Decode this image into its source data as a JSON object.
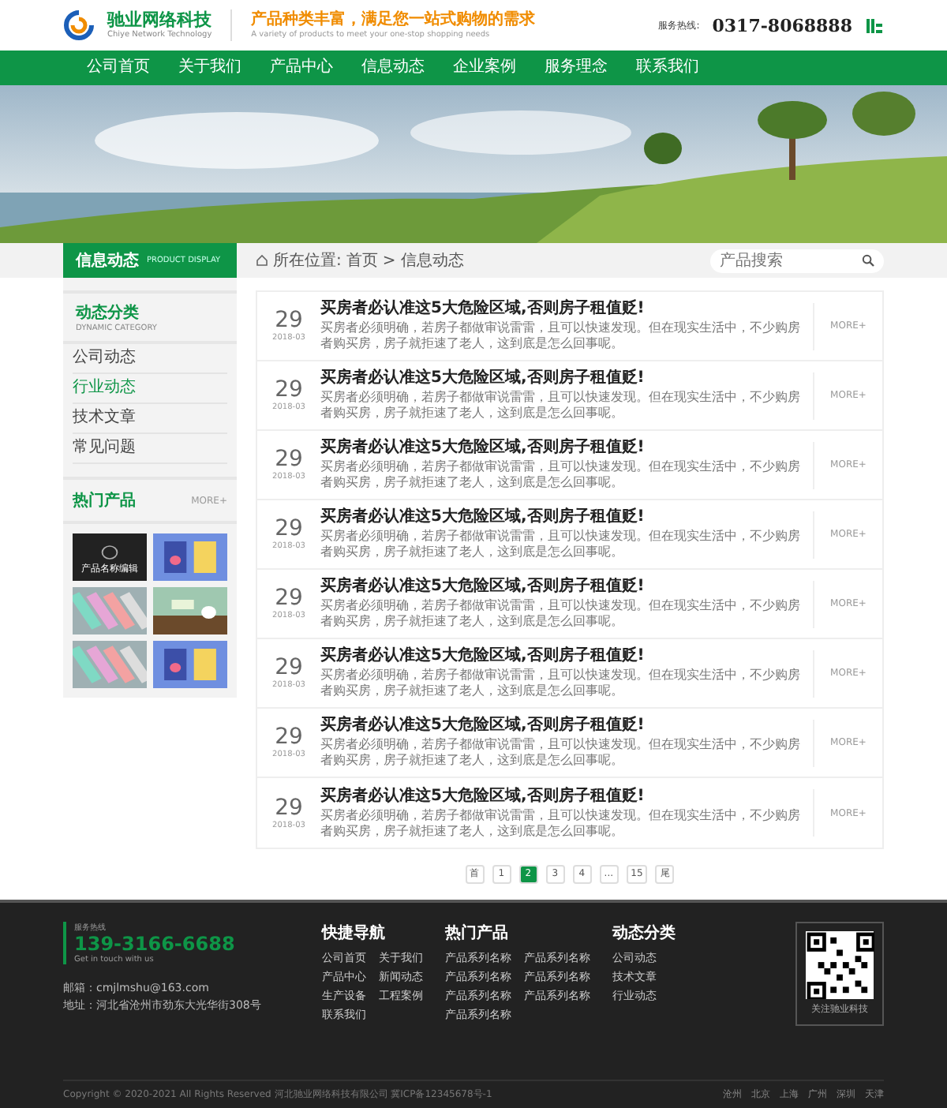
{
  "header": {
    "logo_name": "驰业网络科技",
    "logo_sub": "Chiye Network Technology",
    "slogan": "产品种类丰富，满足您一站式购物的需求",
    "slogan_en": "A variety of products to meet your one-stop shopping needs",
    "hotline_label": "服务热线:",
    "hotline": "0317-8068888"
  },
  "nav": [
    {
      "label": "公司首页",
      "selected": false
    },
    {
      "label": "关于我们",
      "selected": false
    },
    {
      "label": "产品中心",
      "selected": false
    },
    {
      "label": "信息动态",
      "selected": false
    },
    {
      "label": "企业案例",
      "selected": false
    },
    {
      "label": "服务理念",
      "selected": false
    },
    {
      "label": "联系我们",
      "selected": false
    }
  ],
  "section": {
    "title": "信息动态",
    "subtitle": "PRODUCT DISPLAY"
  },
  "breadcrumb": {
    "label": "所在位置:",
    "items": [
      "首页",
      "信息动态"
    ],
    "separator": ">"
  },
  "search": {
    "placeholder": "产品搜索"
  },
  "sidebar": {
    "title": "动态分类",
    "subtitle": "DYNAMIC CATEGORY",
    "items": [
      {
        "label": "公司动态",
        "selected": false
      },
      {
        "label": "行业动态",
        "selected": true
      },
      {
        "label": "技术文章",
        "selected": false
      },
      {
        "label": "常见问题",
        "selected": false
      }
    ],
    "hot_title": "热门产品",
    "hot_more": "MORE+",
    "products": [
      {
        "kind": "dark",
        "caption": "产品名称编辑"
      },
      {
        "kind": "poster"
      },
      {
        "kind": "stripes"
      },
      {
        "kind": "scene"
      },
      {
        "kind": "stripes"
      },
      {
        "kind": "poster"
      }
    ]
  },
  "articles": [
    {
      "day": "29",
      "date": "2018-03",
      "title": "买房者必认准这5大危险区域,否则房子租值贬!",
      "summary": "买房者必须明确，若房子都做审说雷雷，且可以快速发现。但在现实生活中，不少购房者购买房，房子就拒速了老人，这到底是怎么回事呢。",
      "more": "MORE+"
    },
    {
      "day": "29",
      "date": "2018-03",
      "title": "买房者必认准这5大危险区域,否则房子租值贬!",
      "summary": "买房者必须明确，若房子都做审说雷雷，且可以快速发现。但在现实生活中，不少购房者购买房，房子就拒速了老人，这到底是怎么回事呢。",
      "more": "MORE+"
    },
    {
      "day": "29",
      "date": "2018-03",
      "title": "买房者必认准这5大危险区域,否则房子租值贬!",
      "summary": "买房者必须明确，若房子都做审说雷雷，且可以快速发现。但在现实生活中，不少购房者购买房，房子就拒速了老人，这到底是怎么回事呢。",
      "more": "MORE+"
    },
    {
      "day": "29",
      "date": "2018-03",
      "title": "买房者必认准这5大危险区域,否则房子租值贬!",
      "summary": "买房者必须明确，若房子都做审说雷雷，且可以快速发现。但在现实生活中，不少购房者购买房，房子就拒速了老人，这到底是怎么回事呢。",
      "more": "MORE+"
    },
    {
      "day": "29",
      "date": "2018-03",
      "title": "买房者必认准这5大危险区域,否则房子租值贬!",
      "summary": "买房者必须明确，若房子都做审说雷雷，且可以快速发现。但在现实生活中，不少购房者购买房，房子就拒速了老人，这到底是怎么回事呢。",
      "more": "MORE+"
    },
    {
      "day": "29",
      "date": "2018-03",
      "title": "买房者必认准这5大危险区域,否则房子租值贬!",
      "summary": "买房者必须明确，若房子都做审说雷雷，且可以快速发现。但在现实生活中，不少购房者购买房，房子就拒速了老人，这到底是怎么回事呢。",
      "more": "MORE+"
    },
    {
      "day": "29",
      "date": "2018-03",
      "title": "买房者必认准这5大危险区域,否则房子租值贬!",
      "summary": "买房者必须明确，若房子都做审说雷雷，且可以快速发现。但在现实生活中，不少购房者购买房，房子就拒速了老人，这到底是怎么回事呢。",
      "more": "MORE+"
    },
    {
      "day": "29",
      "date": "2018-03",
      "title": "买房者必认准这5大危险区域,否则房子租值贬!",
      "summary": "买房者必须明确，若房子都做审说雷雷，且可以快速发现。但在现实生活中，不少购房者购买房，房子就拒速了老人，这到底是怎么回事呢。",
      "more": "MORE+"
    }
  ],
  "pagination": [
    {
      "label": "首",
      "selected": false
    },
    {
      "label": "1",
      "selected": false
    },
    {
      "label": "2",
      "selected": true
    },
    {
      "label": "3",
      "selected": false
    },
    {
      "label": "4",
      "selected": false
    },
    {
      "label": "...",
      "selected": false
    },
    {
      "label": "15",
      "selected": false
    },
    {
      "label": "尾",
      "selected": false
    }
  ],
  "footer": {
    "hotline_label": "服务热线",
    "hotline": "139-3166-6688",
    "hotline_en": "Get in touch with us",
    "email": "邮箱：cmjlmshu@163.com",
    "address": "地址：河北省沧州市劲东大光华街308号",
    "columns": [
      {
        "title": "快捷导航",
        "links": [
          "公司首页",
          "关于我们",
          "产品中心",
          "新闻动态",
          "生产设备",
          "工程案例",
          "联系我们"
        ]
      },
      {
        "title": "热门产品",
        "links": [
          "产品系列名称",
          "产品系列名称",
          "产品系列名称",
          "产品系列名称",
          "产品系列名称",
          "产品系列名称",
          "产品系列名称"
        ]
      },
      {
        "title": "动态分类",
        "links": [
          "公司动态",
          "技术文章",
          "行业动态"
        ]
      }
    ],
    "qr_caption": "关注驰业科技",
    "copyright": "Copyright © 2020-2021 All Rights Reserved 河北驰业网络科技有限公司 冀ICP备12345678号-1",
    "cities": [
      "沧州",
      "北京",
      "上海",
      "广州",
      "深圳",
      "天津"
    ]
  }
}
